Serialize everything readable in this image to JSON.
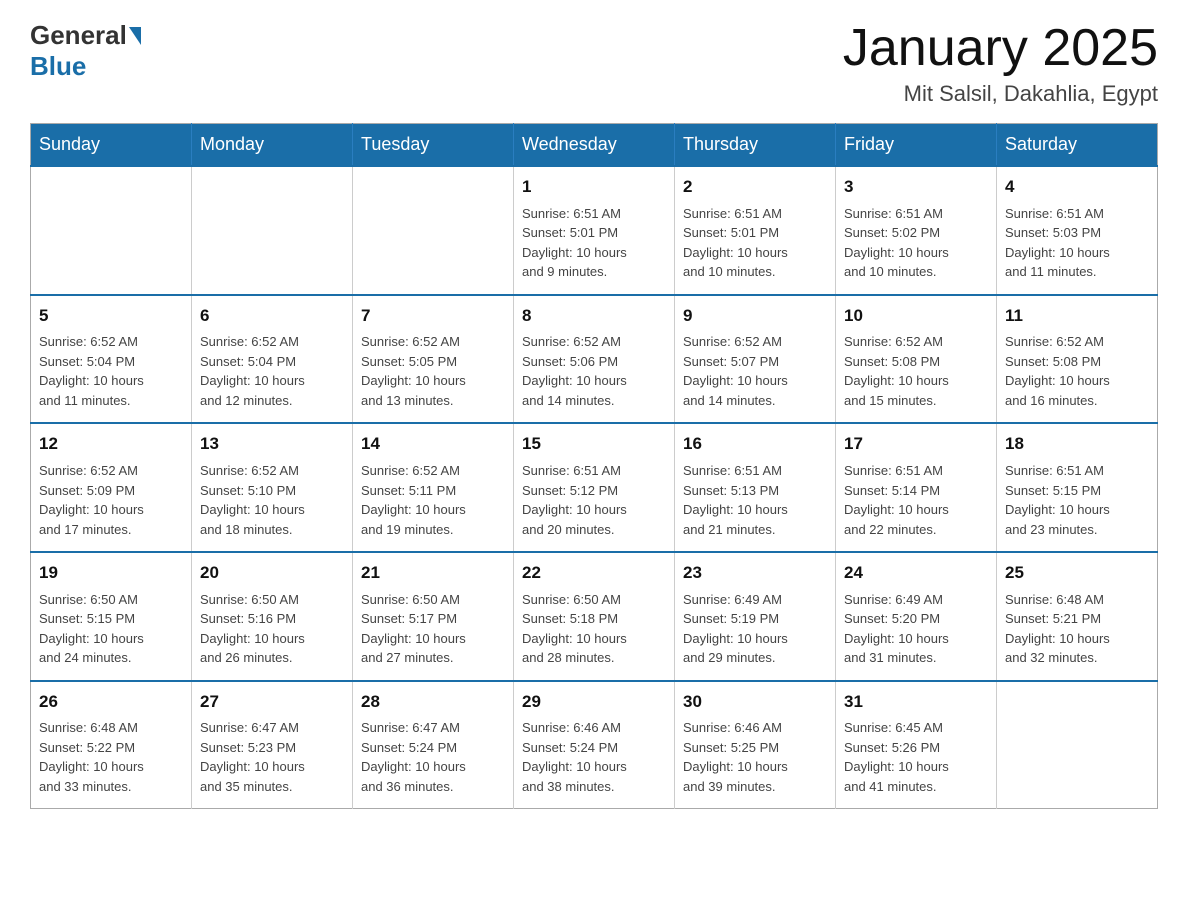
{
  "header": {
    "logo_text_general": "General",
    "logo_text_blue": "Blue",
    "month_title": "January 2025",
    "location": "Mit Salsil, Dakahlia, Egypt"
  },
  "weekdays": [
    "Sunday",
    "Monday",
    "Tuesday",
    "Wednesday",
    "Thursday",
    "Friday",
    "Saturday"
  ],
  "weeks": [
    [
      {
        "day": "",
        "info": ""
      },
      {
        "day": "",
        "info": ""
      },
      {
        "day": "",
        "info": ""
      },
      {
        "day": "1",
        "info": "Sunrise: 6:51 AM\nSunset: 5:01 PM\nDaylight: 10 hours\nand 9 minutes."
      },
      {
        "day": "2",
        "info": "Sunrise: 6:51 AM\nSunset: 5:01 PM\nDaylight: 10 hours\nand 10 minutes."
      },
      {
        "day": "3",
        "info": "Sunrise: 6:51 AM\nSunset: 5:02 PM\nDaylight: 10 hours\nand 10 minutes."
      },
      {
        "day": "4",
        "info": "Sunrise: 6:51 AM\nSunset: 5:03 PM\nDaylight: 10 hours\nand 11 minutes."
      }
    ],
    [
      {
        "day": "5",
        "info": "Sunrise: 6:52 AM\nSunset: 5:04 PM\nDaylight: 10 hours\nand 11 minutes."
      },
      {
        "day": "6",
        "info": "Sunrise: 6:52 AM\nSunset: 5:04 PM\nDaylight: 10 hours\nand 12 minutes."
      },
      {
        "day": "7",
        "info": "Sunrise: 6:52 AM\nSunset: 5:05 PM\nDaylight: 10 hours\nand 13 minutes."
      },
      {
        "day": "8",
        "info": "Sunrise: 6:52 AM\nSunset: 5:06 PM\nDaylight: 10 hours\nand 14 minutes."
      },
      {
        "day": "9",
        "info": "Sunrise: 6:52 AM\nSunset: 5:07 PM\nDaylight: 10 hours\nand 14 minutes."
      },
      {
        "day": "10",
        "info": "Sunrise: 6:52 AM\nSunset: 5:08 PM\nDaylight: 10 hours\nand 15 minutes."
      },
      {
        "day": "11",
        "info": "Sunrise: 6:52 AM\nSunset: 5:08 PM\nDaylight: 10 hours\nand 16 minutes."
      }
    ],
    [
      {
        "day": "12",
        "info": "Sunrise: 6:52 AM\nSunset: 5:09 PM\nDaylight: 10 hours\nand 17 minutes."
      },
      {
        "day": "13",
        "info": "Sunrise: 6:52 AM\nSunset: 5:10 PM\nDaylight: 10 hours\nand 18 minutes."
      },
      {
        "day": "14",
        "info": "Sunrise: 6:52 AM\nSunset: 5:11 PM\nDaylight: 10 hours\nand 19 minutes."
      },
      {
        "day": "15",
        "info": "Sunrise: 6:51 AM\nSunset: 5:12 PM\nDaylight: 10 hours\nand 20 minutes."
      },
      {
        "day": "16",
        "info": "Sunrise: 6:51 AM\nSunset: 5:13 PM\nDaylight: 10 hours\nand 21 minutes."
      },
      {
        "day": "17",
        "info": "Sunrise: 6:51 AM\nSunset: 5:14 PM\nDaylight: 10 hours\nand 22 minutes."
      },
      {
        "day": "18",
        "info": "Sunrise: 6:51 AM\nSunset: 5:15 PM\nDaylight: 10 hours\nand 23 minutes."
      }
    ],
    [
      {
        "day": "19",
        "info": "Sunrise: 6:50 AM\nSunset: 5:15 PM\nDaylight: 10 hours\nand 24 minutes."
      },
      {
        "day": "20",
        "info": "Sunrise: 6:50 AM\nSunset: 5:16 PM\nDaylight: 10 hours\nand 26 minutes."
      },
      {
        "day": "21",
        "info": "Sunrise: 6:50 AM\nSunset: 5:17 PM\nDaylight: 10 hours\nand 27 minutes."
      },
      {
        "day": "22",
        "info": "Sunrise: 6:50 AM\nSunset: 5:18 PM\nDaylight: 10 hours\nand 28 minutes."
      },
      {
        "day": "23",
        "info": "Sunrise: 6:49 AM\nSunset: 5:19 PM\nDaylight: 10 hours\nand 29 minutes."
      },
      {
        "day": "24",
        "info": "Sunrise: 6:49 AM\nSunset: 5:20 PM\nDaylight: 10 hours\nand 31 minutes."
      },
      {
        "day": "25",
        "info": "Sunrise: 6:48 AM\nSunset: 5:21 PM\nDaylight: 10 hours\nand 32 minutes."
      }
    ],
    [
      {
        "day": "26",
        "info": "Sunrise: 6:48 AM\nSunset: 5:22 PM\nDaylight: 10 hours\nand 33 minutes."
      },
      {
        "day": "27",
        "info": "Sunrise: 6:47 AM\nSunset: 5:23 PM\nDaylight: 10 hours\nand 35 minutes."
      },
      {
        "day": "28",
        "info": "Sunrise: 6:47 AM\nSunset: 5:24 PM\nDaylight: 10 hours\nand 36 minutes."
      },
      {
        "day": "29",
        "info": "Sunrise: 6:46 AM\nSunset: 5:24 PM\nDaylight: 10 hours\nand 38 minutes."
      },
      {
        "day": "30",
        "info": "Sunrise: 6:46 AM\nSunset: 5:25 PM\nDaylight: 10 hours\nand 39 minutes."
      },
      {
        "day": "31",
        "info": "Sunrise: 6:45 AM\nSunset: 5:26 PM\nDaylight: 10 hours\nand 41 minutes."
      },
      {
        "day": "",
        "info": ""
      }
    ]
  ]
}
